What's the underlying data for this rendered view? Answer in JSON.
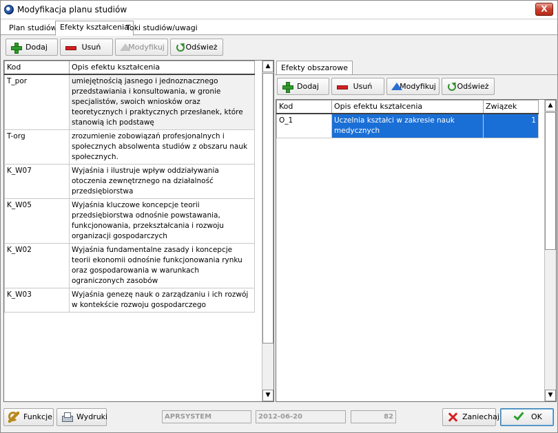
{
  "window": {
    "title": "Modyfikacja planu studiów",
    "close_glyph": "X"
  },
  "tabs": [
    "Plan studiów",
    "Efekty kształcenia",
    "Toki studiów/uwagi"
  ],
  "toolbar_left": {
    "add": "Dodaj",
    "delete": "Usuń",
    "modify": "Modyfikuj",
    "refresh": "Odśwież"
  },
  "left_grid": {
    "columns": [
      "Kod",
      "Opis efektu kształcenia"
    ],
    "rows": [
      {
        "code": "T_por",
        "desc": "umiejętnością jasnego i jednoznacznego przedstawiania i konsultowania, w gronie specjalistów, swoich wniosków oraz teoretycznych i praktycznych przesłanek, które stanowią ich podstawę"
      },
      {
        "code": "T-org",
        "desc": "zrozumienie zobowiązań profesjonalnych i społecznych absolwenta studiów z obszaru nauk społecznych."
      },
      {
        "code": "K_W07",
        "desc": "Wyjaśnia i ilustruje wpływ oddziaływania otoczenia zewnętrznego na działalność przedsiębiorstwa"
      },
      {
        "code": "K_W05",
        "desc": "Wyjaśnia kluczowe koncepcje teorii przedsiębiorstwa odnośnie powstawania, funkcjonowania, przekształcania i rozwoju organizacji gospodarczych"
      },
      {
        "code": "K_W02",
        "desc": "Wyjaśnia fundamentalne zasady i koncepcje teorii ekonomii odnośnie funkcjonowania rynku oraz gospodarowania w warunkach ograniczonych zasobów"
      },
      {
        "code": "K_W03",
        "desc": "Wyjaśnia genezę nauk o zarządzaniu i ich rozwój w kontekście rozwoju gospodarczego"
      }
    ]
  },
  "right_panel": {
    "tab": "Efekty obszarowe",
    "toolbar": {
      "add": "Dodaj",
      "delete": "Usuń",
      "modify": "Modyfikuj",
      "refresh": "Odśwież"
    },
    "columns": [
      "Kod",
      "Opis efektu kształcenia",
      "Związek"
    ],
    "rows": [
      {
        "code": "O_1",
        "desc": "Uczelnia kształci w zakresie nauk medycznych",
        "rel": "1"
      }
    ]
  },
  "bottom": {
    "functions": "Funkcje",
    "prints": "Wydruki",
    "system": "APRSYSTEM",
    "date": "2012-06-20",
    "number": "82",
    "cancel": "Zaniechaj",
    "ok": "OK"
  },
  "colors": {
    "selection": "#1a6fd6",
    "close": "#c8412f"
  }
}
